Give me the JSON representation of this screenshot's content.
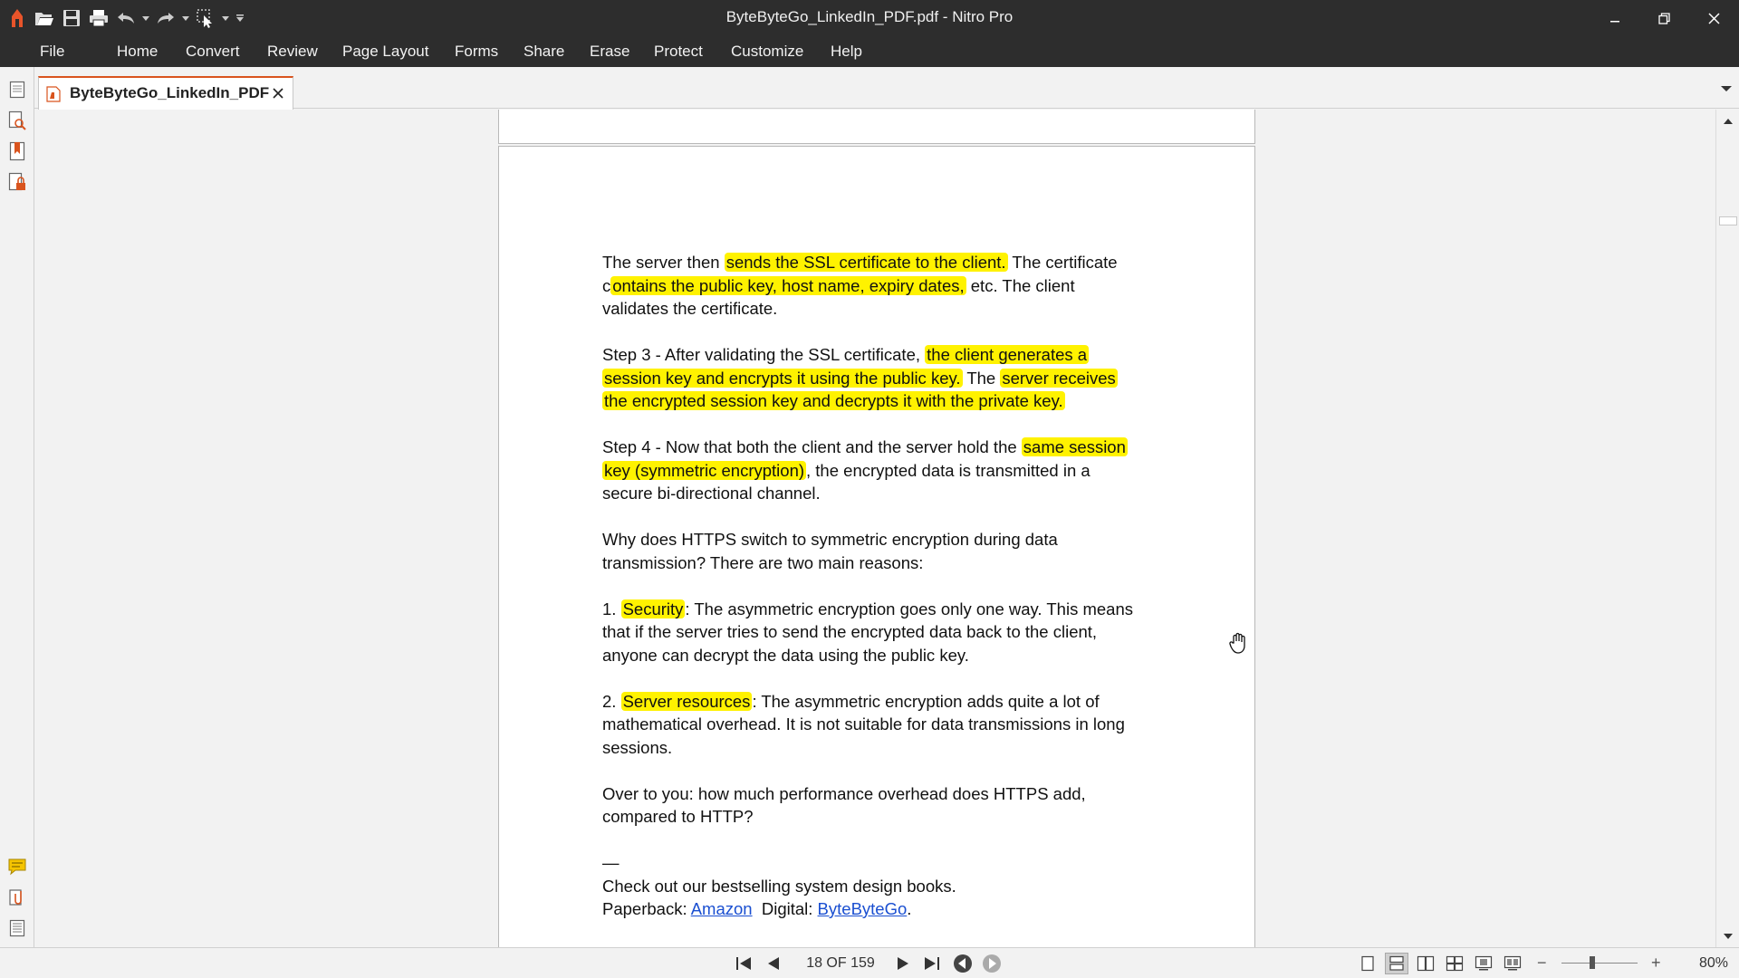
{
  "window": {
    "title": "ByteByteGo_LinkedIn_PDF.pdf - Nitro Pro"
  },
  "quick_access": {
    "icons": [
      "nitro-logo-icon",
      "open-folder-icon",
      "save-icon",
      "print-icon",
      "undo-icon",
      "redo-icon",
      "select-tool-icon",
      "customize-qat-icon"
    ]
  },
  "menu": {
    "items": [
      "File",
      "Home",
      "Convert",
      "Review",
      "Page Layout",
      "Forms",
      "Share",
      "Erase",
      "Protect",
      "Customize",
      "Help"
    ]
  },
  "tab": {
    "label": "ByteByteGo_LinkedIn_PDF"
  },
  "document": {
    "paragraphs": [
      {
        "lines": [
          [
            {
              "t": "The server then "
            },
            {
              "t": "sends the SSL certificate to the client.",
              "hl": true
            },
            {
              "t": " The certificate"
            }
          ],
          [
            {
              "t": "c"
            },
            {
              "t": "ontains the public key, host name, expiry dates,",
              "hl": true
            },
            {
              "t": " etc. The client"
            }
          ],
          [
            {
              "t": "validates the certificate."
            }
          ]
        ]
      },
      {
        "lines": [
          [
            {
              "t": "Step 3 - After validating the SSL certificate, "
            },
            {
              "t": "the client generates a",
              "hl": true
            }
          ],
          [
            {
              "t": "session key and encrypts it using the public key.",
              "hl": true
            },
            {
              "t": " The "
            },
            {
              "t": "server receives",
              "hl": true
            }
          ],
          [
            {
              "t": "the encrypted session key and decrypts it with the private key.",
              "hl": true
            }
          ]
        ]
      },
      {
        "lines": [
          [
            {
              "t": "Step 4 - Now that both the client and the server hold the "
            },
            {
              "t": "same session",
              "hl": true
            }
          ],
          [
            {
              "t": "key (symmetric encryption)",
              "hl": true
            },
            {
              "t": ", the encrypted data is transmitted in a"
            }
          ],
          [
            {
              "t": "secure bi-directional channel."
            }
          ]
        ]
      },
      {
        "lines": [
          [
            {
              "t": "Why does HTTPS switch to symmetric encryption during data"
            }
          ],
          [
            {
              "t": "transmission? There are two main reasons:"
            }
          ]
        ]
      },
      {
        "lines": [
          [
            {
              "t": "1. "
            },
            {
              "t": "Security",
              "hl": true
            },
            {
              "t": ": The asymmetric encryption goes only one way. This means"
            }
          ],
          [
            {
              "t": "that if the server tries to send the encrypted data back to the client,"
            }
          ],
          [
            {
              "t": "anyone can decrypt the data using the public key."
            }
          ]
        ]
      },
      {
        "lines": [
          [
            {
              "t": "2. "
            },
            {
              "t": "Server resources",
              "hl": true
            },
            {
              "t": ": The asymmetric encryption adds quite a lot of"
            }
          ],
          [
            {
              "t": "mathematical overhead. It is not suitable for data transmissions in long"
            }
          ],
          [
            {
              "t": "sessions."
            }
          ]
        ]
      },
      {
        "lines": [
          [
            {
              "t": "Over to you: how much performance overhead does HTTPS add,"
            }
          ],
          [
            {
              "t": "compared to HTTP?"
            }
          ]
        ]
      },
      {
        "tight": true,
        "lines": [
          [
            {
              "t": "—"
            }
          ],
          [
            {
              "t": "Check out our bestselling system design books."
            }
          ],
          [
            {
              "t": "Paperback: "
            },
            {
              "t": "Amazon",
              "link": true
            },
            {
              "t": "  Digital: "
            },
            {
              "t": "ByteByteGo",
              "link": true
            },
            {
              "t": "."
            }
          ]
        ]
      }
    ]
  },
  "status": {
    "page_indicator": "18 OF 159",
    "zoom": "80%",
    "zoom_minus": "−",
    "zoom_plus": "+"
  },
  "colors": {
    "highlight": "#fff200",
    "link": "#1a4fd1",
    "accent": "#d9541e",
    "titlebar": "#2d2d2d"
  }
}
